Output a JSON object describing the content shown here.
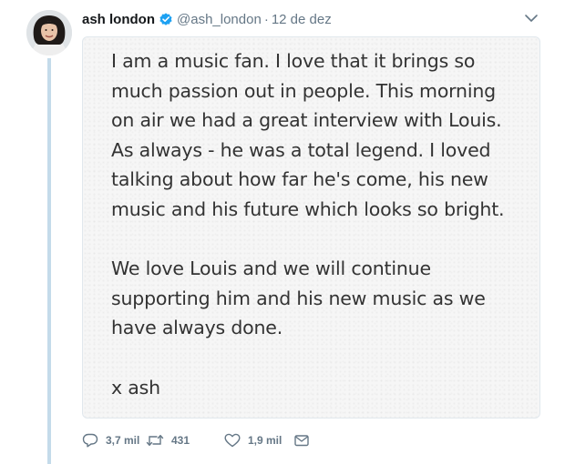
{
  "tweet": {
    "author": {
      "name": "ash london",
      "handle": "@ash_london",
      "separator": "·",
      "date": "12 de dez",
      "verified": true,
      "verified_icon": "verified-badge-icon"
    },
    "note": {
      "paragraph1_lines": [
        "I am a music fan. I love that it brings so",
        "much passion out in people. This morning",
        "on air we had a great interview with Louis.",
        "As always - he was a total legend. I loved",
        "talking about how far he's come, his new",
        "music and his future which looks so bright."
      ],
      "paragraph2_lines": [
        "We love Louis and we will continue",
        "supporting him and his new music as we",
        "have always done."
      ],
      "signature": "x ash"
    },
    "actions": {
      "reply": {
        "icon": "reply-icon",
        "count": "3,7 mil"
      },
      "retweet": {
        "icon": "retweet-icon",
        "count": "431"
      },
      "like": {
        "icon": "heart-icon",
        "count": "1,9 mil"
      },
      "message": {
        "icon": "envelope-icon"
      }
    },
    "menu_icon": "chevron-down-icon"
  },
  "colors": {
    "text_primary": "#14171a",
    "text_secondary": "#657786",
    "verified_blue": "#1da1f2",
    "thread_line": "#c4dbea",
    "note_background": "#f6f6f6",
    "note_text": "#333333"
  }
}
